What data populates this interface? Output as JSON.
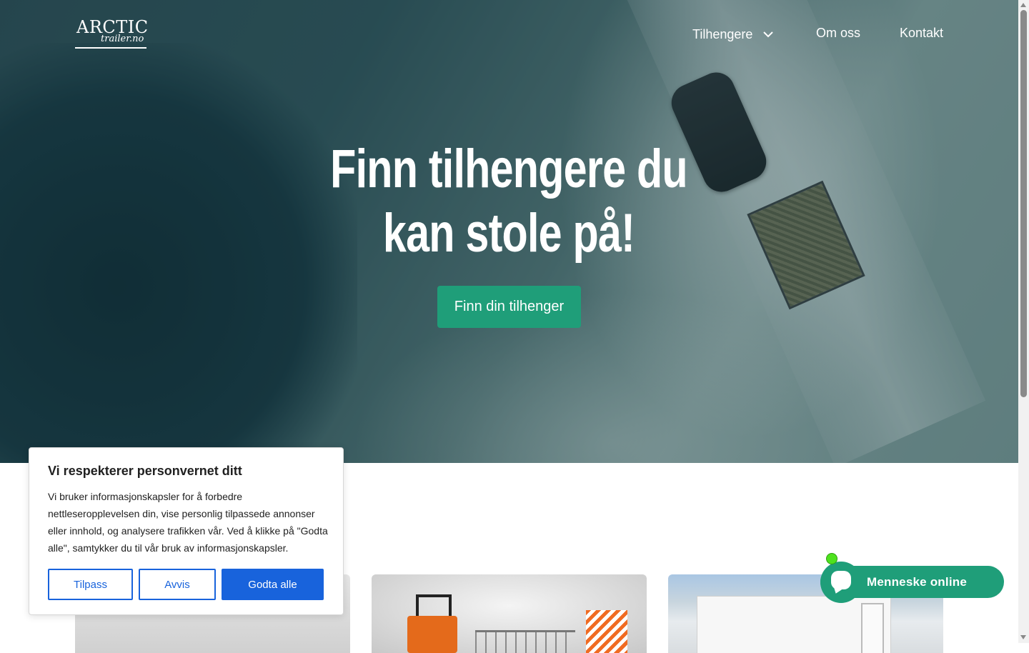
{
  "brand": {
    "logo_line1": "ARCTIC",
    "logo_line2": "trailer.no"
  },
  "nav": {
    "items": [
      {
        "label": "Tilhengere",
        "has_dropdown": true,
        "icon": "chevron-down-icon"
      },
      {
        "label": "Om oss"
      },
      {
        "label": "Kontakt"
      }
    ]
  },
  "hero": {
    "title_line1": "Finn tilhengere du",
    "title_line2": "kan stole på!",
    "cta_label": "Finn din tilhenger"
  },
  "cookie_banner": {
    "title": "Vi respekterer personvernet ditt",
    "text": "Vi bruker informasjonskapsler for å forbedre nettleseropplevelsen din, vise personlig tilpassede annonser eller innhold, og analysere trafikken vår. Ved å klikke på \"Godta alle\", samtykker du til vår bruk av informasjonskapsler.",
    "buttons": {
      "customize": "Tilpass",
      "reject": "Avvis",
      "accept_all": "Godta alle"
    }
  },
  "chat_widget": {
    "label": "Menneske online",
    "status": "online",
    "icon": "chat-bubble-icon"
  },
  "colors": {
    "accent_green": "#1f9e79",
    "cookie_blue": "#1863dc",
    "online_dot": "#4ee21e"
  }
}
